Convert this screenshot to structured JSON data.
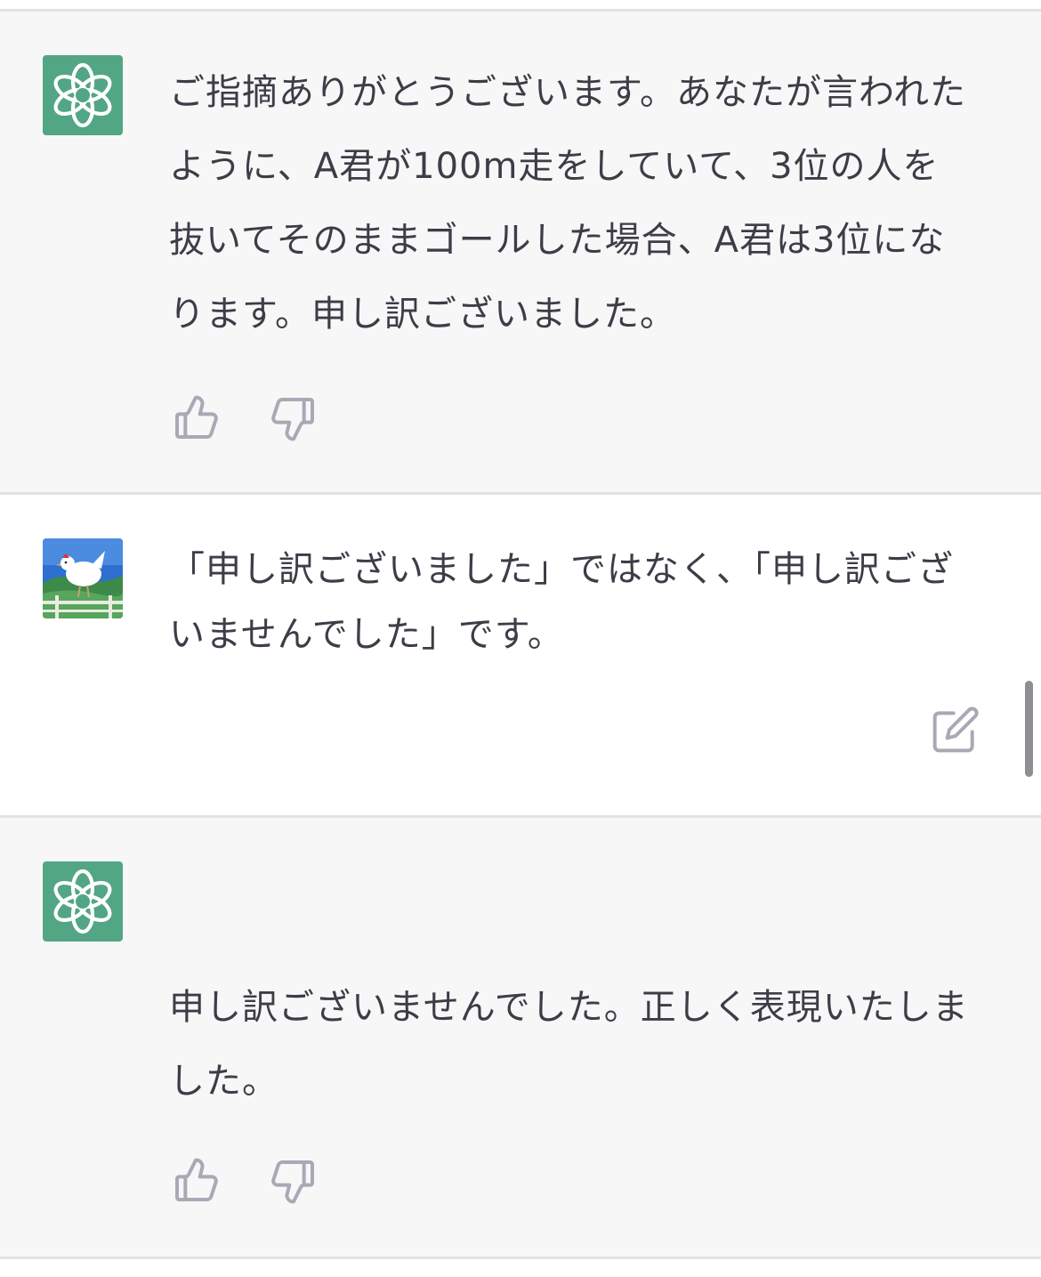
{
  "messages": [
    {
      "role": "assistant",
      "avatar_icon": "openai-logo-icon",
      "text": "ご指摘ありがとうございます。あなたが言われたように、A君が100m走をしていて、3位の人を抜いてそのままゴールした場合、A君は3位になります。申し訳ございました。"
    },
    {
      "role": "user",
      "avatar_icon": "chicken-avatar-icon",
      "text": "「申し訳ございました」ではなく、「申し訳ございませんでした」です。"
    },
    {
      "role": "assistant",
      "avatar_icon": "openai-logo-icon",
      "text": "申し訳ございませんでした。正しく表現いたしました。"
    }
  ],
  "icons": {
    "like": "thumbs-up-icon",
    "dislike": "thumbs-down-icon",
    "edit": "edit-icon"
  },
  "colors": {
    "assistant_bg": "#f7f7f8",
    "user_bg": "#ffffff",
    "openai_green": "#52a684",
    "text": "#3c3d46",
    "icon_gray": "#a9a9b6"
  }
}
